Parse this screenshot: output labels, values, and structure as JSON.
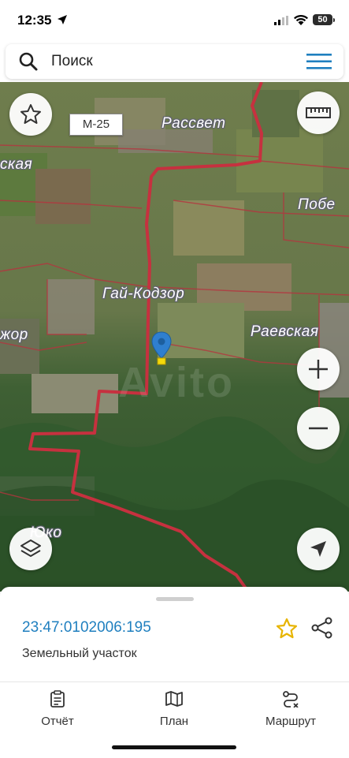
{
  "status_bar": {
    "time": "12:35",
    "battery": "50"
  },
  "search": {
    "placeholder": "Поиск"
  },
  "map": {
    "road_sign": "М-25",
    "labels": {
      "rassvet": "Рассвет",
      "skaya": "ская",
      "pobed": "Побе",
      "gay_kodzor": "Гай-Кодзор",
      "zhor": "жор",
      "raevskaya": "Раевская",
      "yuko": "Юко"
    },
    "watermark": "Avito",
    "colors": {
      "boundary": "#c6313f",
      "pin": "#2f7fcf",
      "pin_tag": "#f5d90a"
    }
  },
  "parcel": {
    "cadastral_number": "23:47:0102006:195",
    "type": "Земельный участок"
  },
  "tabs": [
    {
      "label": "Отчёт",
      "icon": "report-icon"
    },
    {
      "label": "План",
      "icon": "map-plan-icon"
    },
    {
      "label": "Маршрут",
      "icon": "route-icon"
    }
  ],
  "colors": {
    "accent": "#1f7fbf",
    "menu": "#1f7fbf",
    "star": "#e7b400"
  }
}
